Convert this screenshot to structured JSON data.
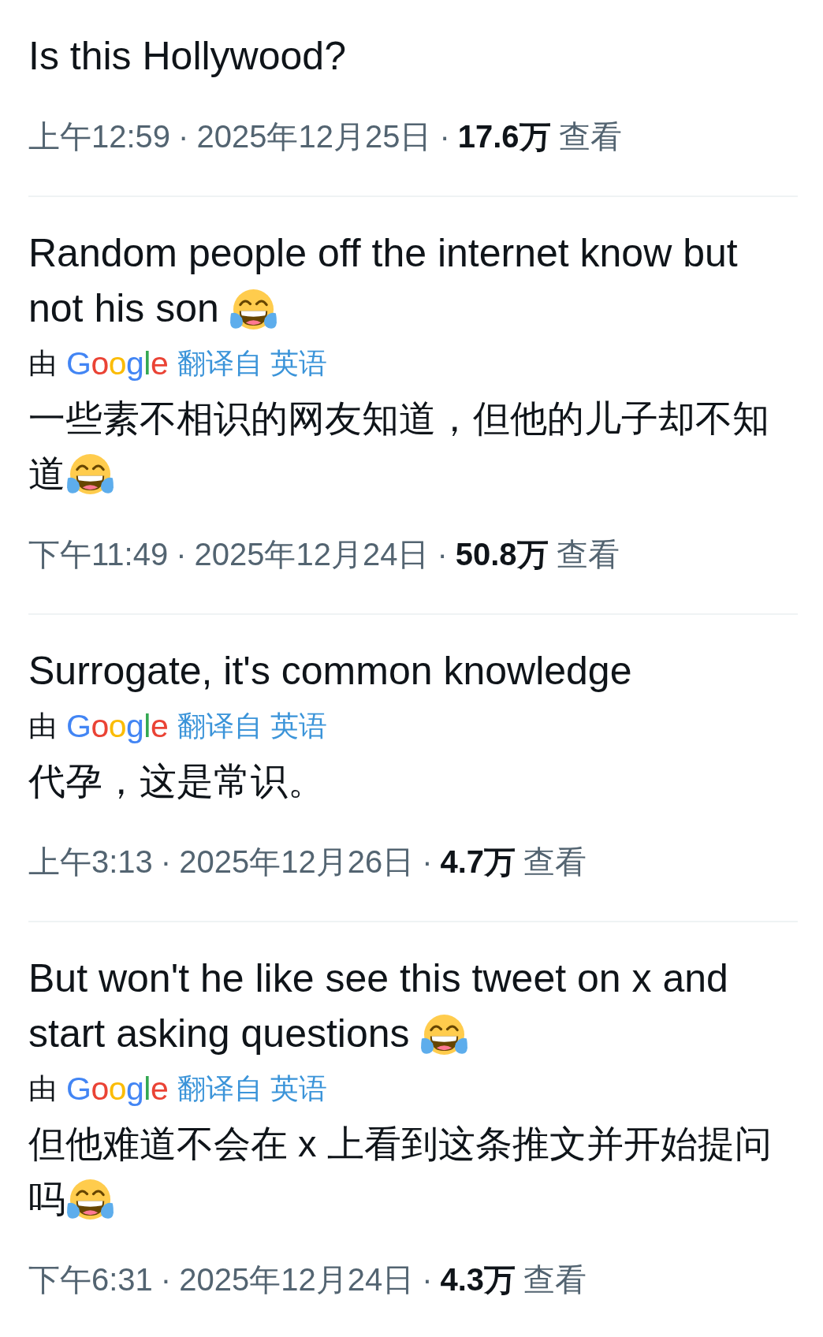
{
  "replies": [
    {
      "text": "Is this Hollywood?",
      "ends_with_emoji": false,
      "meta": [
        {
          "kind": "time",
          "text": "上午12:59"
        },
        {
          "kind": "separator",
          "text": "·"
        },
        {
          "kind": "date",
          "text": "2025年12月25日"
        },
        {
          "kind": "separator",
          "text": "·"
        },
        {
          "kind": "views",
          "text": "17.6万"
        },
        {
          "kind": "views_label",
          "text": "查看"
        }
      ]
    },
    {
      "text": "Random people off the internet know but not his son",
      "ends_with_emoji": true,
      "translation": {
        "by": "由",
        "provider": "Google",
        "link": "翻译自 英语",
        "text": "一些素不相识的网友知道，但他的儿子却不知道",
        "ends_with_emoji": true
      },
      "meta": [
        {
          "kind": "time",
          "text": "下午11:49"
        },
        {
          "kind": "separator",
          "text": "·"
        },
        {
          "kind": "date",
          "text": "2025年12月24日"
        },
        {
          "kind": "separator",
          "text": "·"
        },
        {
          "kind": "views",
          "text": "50.8万"
        },
        {
          "kind": "views_label",
          "text": "查看"
        }
      ]
    },
    {
      "text": "Surrogate, it's common knowledge",
      "ends_with_emoji": false,
      "translation": {
        "by": "由",
        "provider": "Google",
        "link": "翻译自 英语",
        "text": "代孕，这是常识。",
        "ends_with_emoji": false
      },
      "meta": [
        {
          "kind": "time",
          "text": "上午3:13"
        },
        {
          "kind": "separator",
          "text": "·"
        },
        {
          "kind": "date",
          "text": "2025年12月26日"
        },
        {
          "kind": "separator",
          "text": "·"
        },
        {
          "kind": "views",
          "text": "4.7万"
        },
        {
          "kind": "views_label",
          "text": "查看"
        }
      ]
    },
    {
      "text": "But won't he like see this tweet on x and start asking questions",
      "ends_with_emoji": true,
      "translation": {
        "by": "由",
        "provider": "Google",
        "link": "翻译自 英语",
        "text": "但他难道不会在 x 上看到这条推文并开始提问吗",
        "ends_with_emoji": true
      },
      "meta": [
        {
          "kind": "time",
          "text": "下午6:31"
        },
        {
          "kind": "separator",
          "text": "·"
        },
        {
          "kind": "date",
          "text": "2025年12月24日"
        },
        {
          "kind": "separator",
          "text": "·"
        },
        {
          "kind": "views",
          "text": "4.3万"
        },
        {
          "kind": "views_label",
          "text": "查看"
        }
      ]
    }
  ]
}
